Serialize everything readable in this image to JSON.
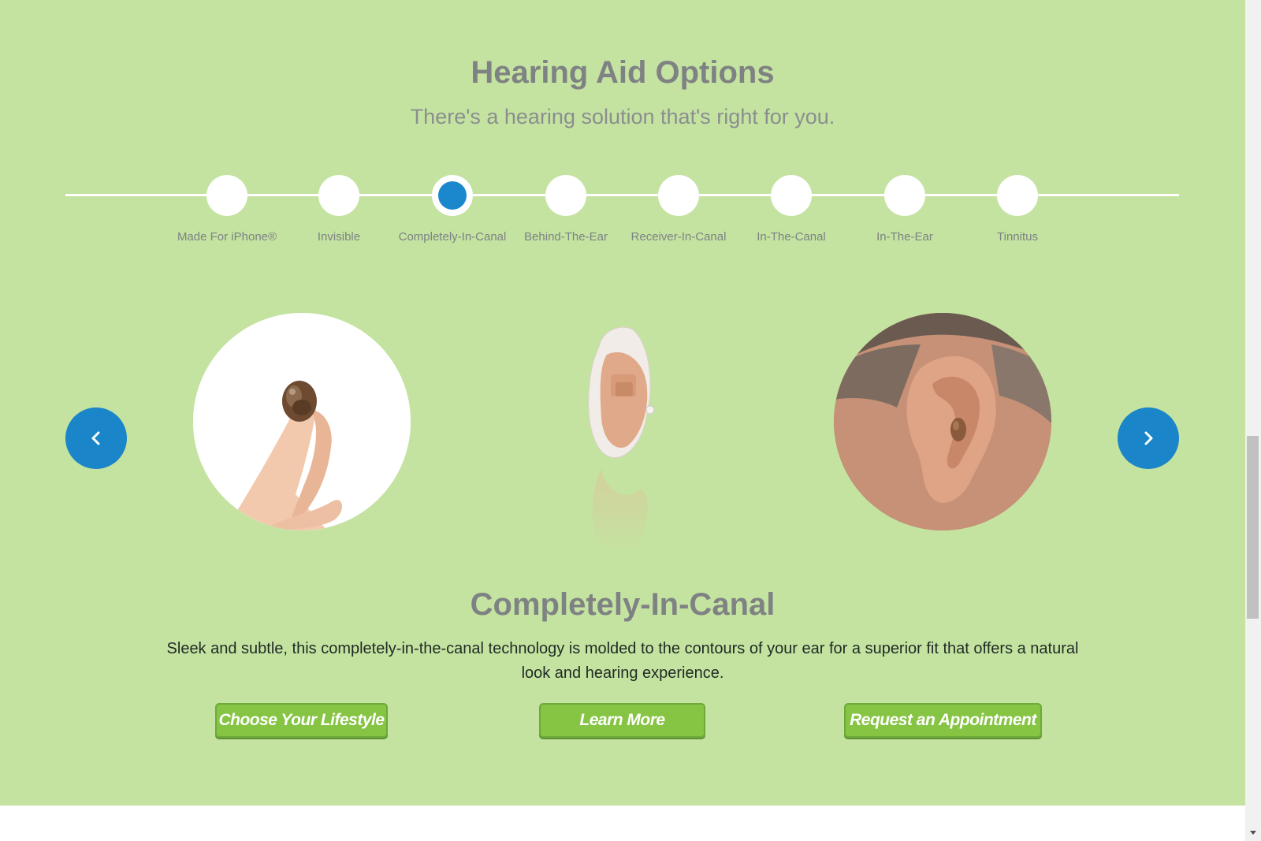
{
  "section": {
    "title": "Hearing Aid Options",
    "subtitle": "There's a hearing solution that's right for you."
  },
  "timeline": {
    "active_index": 2,
    "steps": [
      {
        "label": "Made For iPhone®"
      },
      {
        "label": "Invisible"
      },
      {
        "label": "Completely-In-Canal"
      },
      {
        "label": "Behind-The-Ear"
      },
      {
        "label": "Receiver-In-Canal"
      },
      {
        "label": "In-The-Canal"
      },
      {
        "label": "In-The-Ear"
      },
      {
        "label": "Tinnitus"
      }
    ]
  },
  "carousel": {
    "prev_icon": "chevron-left-icon",
    "next_icon": "chevron-right-icon"
  },
  "product": {
    "title": "Completely-In-Canal",
    "description": "Sleek and subtle, this completely-in-the-canal technology is molded to the contours of your ear for a superior fit that offers a natural look and hearing experience."
  },
  "buttons": {
    "lifestyle": "Choose Your Lifestyle",
    "learn_more": "Learn More",
    "appointment": "Request an Appointment"
  },
  "colors": {
    "background": "#c4e3a1",
    "accent_blue": "#1b85c9",
    "button_green": "#86c443",
    "heading_gray": "#7f8283"
  }
}
